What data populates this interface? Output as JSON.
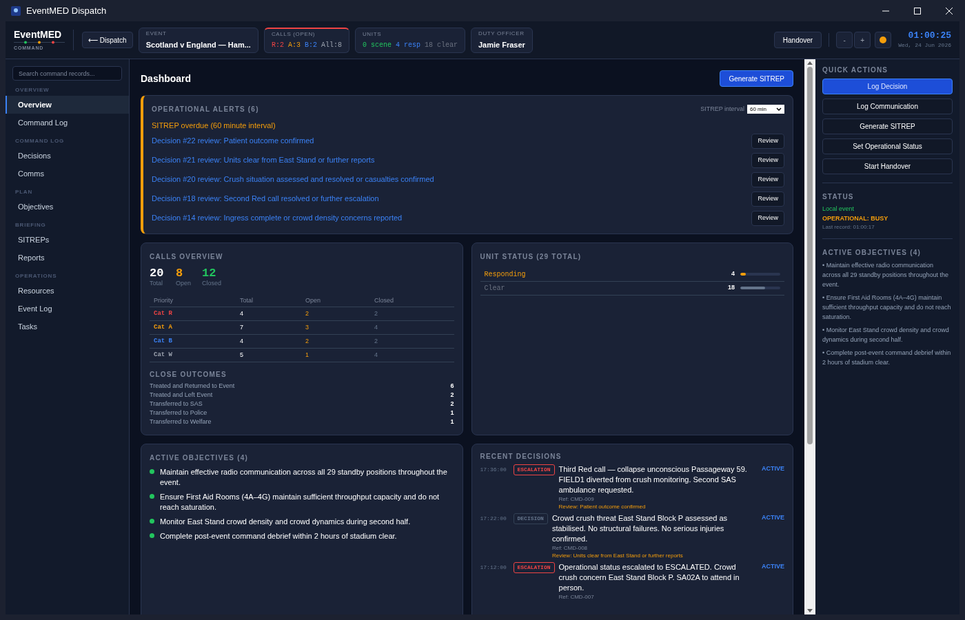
{
  "window": {
    "title": "EventMED Dispatch"
  },
  "header": {
    "brand": "EventMED",
    "brand_subtitle": "COMMAND",
    "back_button": "⟵ Dispatch",
    "tiles": [
      {
        "label": "EVENT",
        "highlighted": false,
        "parts": [
          {
            "text": "Scotland v England — Ham...",
            "color": "#ffffff"
          }
        ]
      },
      {
        "label": "CALLS (OPEN)",
        "highlighted": true,
        "parts": [
          {
            "text": "R:2",
            "color": "#ef4444"
          },
          {
            "text": "A:3",
            "color": "#f59e0b"
          },
          {
            "text": "B:2",
            "color": "#3b82f6"
          },
          {
            "text": "All:8",
            "color": "#9ca3af"
          }
        ]
      },
      {
        "label": "UNITS",
        "highlighted": false,
        "parts": [
          {
            "text": "0 scene",
            "color": "#22c55e"
          },
          {
            "text": "4 resp",
            "color": "#3b82f6"
          },
          {
            "text": "18 clear",
            "color": "#6b7280"
          }
        ]
      },
      {
        "label": "DUTY OFFICER",
        "highlighted": false,
        "parts": [
          {
            "text": "Jamie Fraser",
            "color": "#ffffff"
          }
        ]
      }
    ],
    "handover_button": "Handover",
    "zoom_out": "-",
    "zoom_in": "+",
    "time": "01:00:25",
    "date": "Wed, 24 Jun 2026"
  },
  "sidebar": {
    "search_placeholder": "Search command records...",
    "sections": [
      {
        "heading": "OVERVIEW",
        "items": [
          {
            "label": "Overview",
            "selected": true
          },
          {
            "label": "Command Log",
            "selected": false
          }
        ]
      },
      {
        "heading": "COMMAND LOG",
        "items": [
          {
            "label": "Decisions",
            "selected": false
          },
          {
            "label": "Comms",
            "selected": false
          }
        ]
      },
      {
        "heading": "PLAN",
        "items": [
          {
            "label": "Objectives",
            "selected": false
          }
        ]
      },
      {
        "heading": "BRIEFING",
        "items": [
          {
            "label": "SITREPs",
            "selected": false
          },
          {
            "label": "Reports",
            "selected": false
          }
        ]
      },
      {
        "heading": "OPERATIONS",
        "items": [
          {
            "label": "Resources",
            "selected": false
          },
          {
            "label": "Event Log",
            "selected": false
          },
          {
            "label": "Tasks",
            "selected": false
          }
        ]
      }
    ]
  },
  "main": {
    "title": "Dashboard",
    "primary_button": "Generate SITREP",
    "alerts": {
      "title": "OPERATIONAL ALERTS (6)",
      "interval_label": "SITREP interval",
      "interval_value": "60 min",
      "overdue": "SITREP overdue (60 minute interval)",
      "items": [
        {
          "text": "Decision #22 review: Patient outcome confirmed",
          "button": "Review"
        },
        {
          "text": "Decision #21 review: Units clear from East Stand or further reports",
          "button": "Review"
        },
        {
          "text": "Decision #20 review: Crush situation assessed and resolved or casualties confirmed",
          "button": "Review"
        },
        {
          "text": "Decision #18 review: Second Red call resolved or further escalation",
          "button": "Review"
        },
        {
          "text": "Decision #14 review: Ingress complete or crowd density concerns reported",
          "button": "Review"
        }
      ]
    },
    "calls_overview": {
      "title": "CALLS OVERVIEW",
      "totals": [
        {
          "value": "20",
          "label": "Total",
          "color": "#ffffff"
        },
        {
          "value": "8",
          "label": "Open",
          "color": "#f59e0b"
        },
        {
          "value": "12",
          "label": "Closed",
          "color": "#22c55e"
        }
      ],
      "columns": [
        "Priority",
        "Total",
        "Open",
        "Closed"
      ],
      "rows": [
        {
          "priority": "Cat R",
          "color": "#ef4444",
          "total": "4",
          "open": "2",
          "closed": "2"
        },
        {
          "priority": "Cat A",
          "color": "#f59e0b",
          "total": "7",
          "open": "3",
          "closed": "4"
        },
        {
          "priority": "Cat B",
          "color": "#3b82f6",
          "total": "4",
          "open": "2",
          "closed": "2"
        },
        {
          "priority": "Cat W",
          "color": "#9ca3af",
          "total": "5",
          "open": "1",
          "closed": "4"
        }
      ],
      "outcomes_title": "CLOSE OUTCOMES",
      "outcomes": [
        {
          "label": "Treated and Returned to Event",
          "count": "6"
        },
        {
          "label": "Treated and Left Event",
          "count": "2"
        },
        {
          "label": "Transferred to SAS",
          "count": "2"
        },
        {
          "label": "Transferred to Police",
          "count": "1"
        },
        {
          "label": "Transferred to Welfare",
          "count": "1"
        }
      ]
    },
    "unit_status": {
      "title": "UNIT STATUS (29 TOTAL)",
      "rows": [
        {
          "label": "Responding",
          "count": "4",
          "level": 0.14,
          "color": "#f59e0b"
        },
        {
          "label": "Clear",
          "count": "18",
          "level": 0.62,
          "color": "#6b7280"
        }
      ]
    },
    "objectives": {
      "title": "ACTIVE OBJECTIVES (4)",
      "items": [
        "Maintain effective radio communication across all 29 standby positions throughout the event.",
        "Ensure First Aid Rooms (4A–4G) maintain sufficient throughput capacity and do not reach saturation.",
        "Monitor East Stand crowd density and crowd dynamics during second half.",
        "Complete post-event command debrief within 2 hours of stadium clear."
      ]
    },
    "decisions": {
      "title": "RECENT DECISIONS",
      "items": [
        {
          "time": "17:36:00",
          "kind": "escalation",
          "tag": "ESCALATION",
          "text": "Third Red call — collapse unconscious Passageway 59. FIELD1 diverted from crush monitoring. Second SAS ambulance requested.",
          "ref": "Ref: CMD-009",
          "review": "Review: Patient outcome confirmed",
          "status": "ACTIVE"
        },
        {
          "time": "17:22:00",
          "kind": "decision",
          "tag": "DECISION",
          "text": "Crowd crush threat East Stand Block P assessed as stabilised. No structural failures. No serious injuries confirmed.",
          "ref": "Ref: CMD-008",
          "review": "Review: Units clear from East Stand or further reports",
          "status": "ACTIVE"
        },
        {
          "time": "17:12:00",
          "kind": "escalation",
          "tag": "ESCALATION",
          "text": "Operational status escalated to ESCALATED. Crowd crush concern East Stand Block P. SA02A to attend in person.",
          "ref": "Ref: CMD-007",
          "status": "ACTIVE"
        }
      ]
    }
  },
  "right_panel": {
    "quick_actions_title": "QUICK ACTIONS",
    "actions": [
      {
        "label": "Log Decision",
        "primary": true
      },
      {
        "label": "Log Communication",
        "primary": false
      },
      {
        "label": "Generate SITREP",
        "primary": false
      },
      {
        "label": "Set Operational Status",
        "primary": false
      },
      {
        "label": "Start Handover",
        "primary": false
      }
    ],
    "status": {
      "title": "STATUS",
      "scope": "Local event",
      "operational": "OPERATIONAL: BUSY",
      "last_record": "Last record: 01:00:17"
    },
    "objectives_title": "ACTIVE OBJECTIVES (4)",
    "objectives": [
      "• Maintain effective radio communication across all 29 standby positions throughout the event.",
      "• Ensure First Aid Rooms (4A–4G) maintain sufficient throughput capacity and do not reach saturation.",
      "• Monitor East Stand crowd density and crowd dynamics during second half.",
      "• Complete post-event command debrief within 2 hours of stadium clear."
    ]
  }
}
